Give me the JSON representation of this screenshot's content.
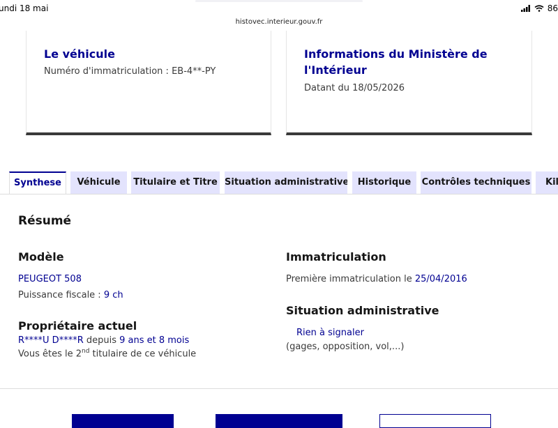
{
  "status_bar": {
    "time": "undi 18 mai",
    "battery": "86",
    "url": "histovec.interieur.gouv.fr"
  },
  "cards": {
    "vehicle": {
      "title": "Le véhicule",
      "plate_label": "Numéro d'immatriculation : EB-4**-PY"
    },
    "ministry": {
      "title": "Informations du Ministère de l'Intérieur",
      "date_label": "Datant du 18/05/2026"
    }
  },
  "tabs": [
    {
      "label": "Synthese",
      "active": true
    },
    {
      "label": "Véhicule",
      "active": false
    },
    {
      "label": "Titulaire et Titre",
      "active": false
    },
    {
      "label": "Situation administrative",
      "active": false
    },
    {
      "label": "Historique",
      "active": false
    },
    {
      "label": "Contrôles techniques",
      "active": false
    },
    {
      "label": "Kilo",
      "active": false
    }
  ],
  "resume": {
    "heading": "Résumé",
    "model": {
      "heading": "Modèle",
      "name": "PEUGEOT 508",
      "fiscal_prefix": "Puissance fiscale : ",
      "fiscal_value": "9 ch"
    },
    "owner": {
      "heading": "Propriétaire actuel",
      "name": "R****U D****R",
      "since_prefix": " depuis ",
      "since_value": "9 ans et 8 mois",
      "rank_prefix": "Vous êtes le 2",
      "rank_sup": "nd",
      "rank_suffix": " titulaire de ce véhicule"
    },
    "registration": {
      "heading": "Immatriculation",
      "first_prefix": "Première immatriculation le ",
      "first_date": "25/04/2016"
    },
    "admin": {
      "heading": "Situation administrative",
      "status": "Rien à signaler",
      "detail": "(gages, opposition, vol,...)"
    }
  }
}
